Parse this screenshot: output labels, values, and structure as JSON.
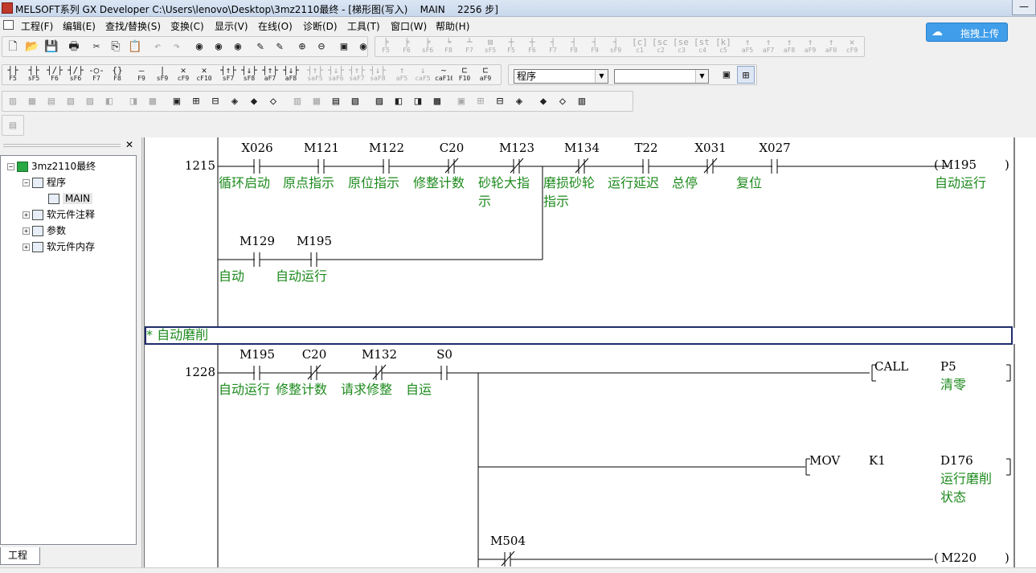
{
  "window": {
    "title": "MELSOFT系列 GX Developer C:\\Users\\lenovo\\Desktop\\3mz2110最终 - [梯形图(写入)    MAIN    2256 步]",
    "minimize_glyph": "—"
  },
  "menu": [
    "工程(F)",
    "编辑(E)",
    "查找/替换(S)",
    "变换(C)",
    "显示(V)",
    "在线(O)",
    "诊断(D)",
    "工具(T)",
    "窗口(W)",
    "帮助(H)"
  ],
  "cloud_button": {
    "label": "拖拽上传",
    "icon": "baidu-cloud-icon"
  },
  "toolbar1": {
    "icons": [
      "new-file-icon",
      "open-folder-icon",
      "save-icon",
      "print-icon",
      "cut-icon",
      "copy-icon",
      "paste-icon",
      "undo-icon",
      "redo-icon",
      "find-device-icon",
      "find-instruction-icon",
      "find-step-icon",
      "write-icon",
      "read-icon",
      "zoom-in-icon",
      "zoom-out-icon",
      "monitor-icon",
      "monitor-write-icon"
    ],
    "keys": [
      {
        "g": "╞",
        "k": "F5"
      },
      {
        "g": "╞",
        "k": "F6"
      },
      {
        "g": "╞",
        "k": "sF6"
      },
      {
        "g": "╘",
        "k": "F8"
      },
      {
        "g": "┴",
        "k": "F7"
      },
      {
        "g": "⊠",
        "k": "sF5"
      },
      {
        "g": "┼",
        "k": "F5"
      },
      {
        "g": "┼",
        "k": "F6"
      },
      {
        "g": "┤",
        "k": "F7"
      },
      {
        "g": "┤",
        "k": "F8"
      },
      {
        "g": "┤",
        "k": "F9"
      },
      {
        "g": "┤",
        "k": "sF9"
      },
      {
        "g": "[c]",
        "k": "c1"
      },
      {
        "g": "[sc]",
        "k": "c2"
      },
      {
        "g": "[se]",
        "k": "c3"
      },
      {
        "g": "[st]",
        "k": "c4"
      },
      {
        "g": "[k]",
        "k": "c5"
      },
      {
        "g": "↑",
        "k": "aF5"
      },
      {
        "g": "↑",
        "k": "aF7"
      },
      {
        "g": "↑",
        "k": "aF8"
      },
      {
        "g": "↑",
        "k": "aF9"
      },
      {
        "g": "↑",
        "k": "aF0"
      },
      {
        "g": "✕",
        "k": "cF9"
      }
    ]
  },
  "toolbar2": {
    "keys": [
      {
        "g": "┤├",
        "k": "F5"
      },
      {
        "g": "┤├",
        "k": "sF5"
      },
      {
        "g": "┤/├",
        "k": "F6"
      },
      {
        "g": "┤/├",
        "k": "sF6"
      },
      {
        "g": "-○-",
        "k": "F7"
      },
      {
        "g": "{}",
        "k": "F8"
      },
      {
        "g": "—",
        "k": "F9"
      },
      {
        "g": "|",
        "k": "sF9"
      },
      {
        "g": "✕",
        "k": "cF9"
      },
      {
        "g": "✕",
        "k": "cF10"
      },
      {
        "g": "┤↑├",
        "k": "sF7"
      },
      {
        "g": "┤↓├",
        "k": "sF8"
      },
      {
        "g": "┤↑├",
        "k": "aF7"
      },
      {
        "g": "┤↓├",
        "k": "aF8"
      },
      {
        "g": "┤↑├",
        "k": "saF5"
      },
      {
        "g": "┤↓├",
        "k": "saF6"
      },
      {
        "g": "┤↑├",
        "k": "saF7"
      },
      {
        "g": "┤↓├",
        "k": "saF8"
      },
      {
        "g": "↑",
        "k": "aF5"
      },
      {
        "g": "↓",
        "k": "caF5"
      },
      {
        "g": "~",
        "k": "caF10"
      },
      {
        "g": "⊏",
        "k": "F10"
      },
      {
        "g": "⊏",
        "k": "aF9"
      }
    ],
    "select_program": "程序",
    "select_empty": ""
  },
  "tree": {
    "close_glyph": "✕",
    "project": "3mz2110最终",
    "program_folder": "程序",
    "main": "MAIN",
    "device_comment": "软元件注释",
    "parameter": "参数",
    "device_memory": "软元件内存",
    "tab_label": "工程",
    "expanded": "−",
    "collapsed": "+"
  },
  "ladder": {
    "rung1": {
      "step": "1215",
      "contacts": [
        {
          "dev": "X026",
          "cmt": [
            "循环启动"
          ],
          "nc": false
        },
        {
          "dev": "M121",
          "cmt": [
            "原点指示"
          ],
          "nc": false
        },
        {
          "dev": "M122",
          "cmt": [
            "原位指示"
          ],
          "nc": false
        },
        {
          "dev": "C20",
          "cmt": [
            "修整计数"
          ],
          "nc": true
        },
        {
          "dev": "M123",
          "cmt": [
            "砂轮大指",
            "示"
          ],
          "nc": true
        },
        {
          "dev": "M134",
          "cmt": [
            "磨损砂轮",
            "指示"
          ],
          "nc": true
        },
        {
          "dev": "T22",
          "cmt": [
            "运行延迟"
          ],
          "nc": false
        },
        {
          "dev": "X031",
          "cmt": [
            "总停"
          ],
          "nc": true
        },
        {
          "dev": "X027",
          "cmt": [
            "复位"
          ],
          "nc": false
        }
      ],
      "branch": [
        {
          "dev": "M129",
          "cmt": [
            "自动"
          ],
          "nc": false
        },
        {
          "dev": "M195",
          "cmt": [
            "自动运行"
          ],
          "nc": false
        }
      ],
      "coil": {
        "dev": "M195",
        "cmt": "自动运行"
      }
    },
    "comment_banner": "* 自动磨削",
    "rung2": {
      "step": "1228",
      "contacts": [
        {
          "dev": "M195",
          "cmt": [
            "自动运行"
          ],
          "nc": false
        },
        {
          "dev": "C20",
          "cmt": [
            "修整计数"
          ],
          "nc": true
        },
        {
          "dev": "M132",
          "cmt": [
            "请求修整"
          ],
          "nc": true
        },
        {
          "dev": "S0",
          "cmt": [
            "自运"
          ],
          "nc": false
        }
      ],
      "call": {
        "op": "CALL",
        "arg": "P5",
        "arg_cmt": "清零"
      },
      "mov": {
        "op": "MOV",
        "src": "K1",
        "dst": "D176",
        "dst_cmt": [
          "运行磨削",
          "状态"
        ]
      },
      "m504": {
        "dev": "M504",
        "nc": true
      },
      "coil": {
        "dev": "M220"
      }
    }
  }
}
